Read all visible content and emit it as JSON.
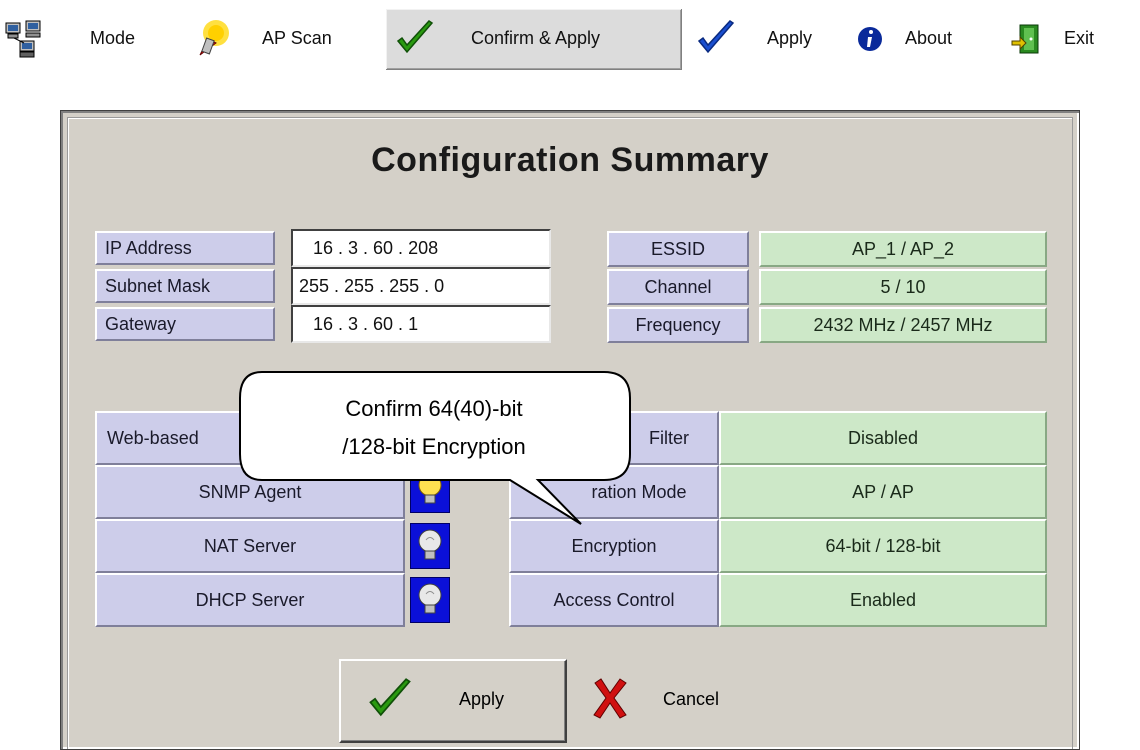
{
  "toolbar": {
    "mode": "Mode",
    "ap_scan": "AP Scan",
    "confirm_apply": "Confirm & Apply",
    "apply": "Apply",
    "about": "About",
    "exit": "Exit"
  },
  "dialog": {
    "title": "Configuration Summary",
    "network": {
      "ip_label": "IP Address",
      "ip_value": "16  .  3  .  60  . 208",
      "subnet_label": "Subnet Mask",
      "subnet_value": "255 . 255 . 255 .   0",
      "gateway_label": "Gateway",
      "gateway_value": "16  .  3  .  60  .   1"
    },
    "wireless": {
      "essid_label": "ESSID",
      "essid_value": "AP_1 / AP_2",
      "channel_label": "Channel",
      "channel_value": "5 / 10",
      "frequency_label": "Frequency",
      "frequency_value": "2432 MHz / 2457 MHz"
    },
    "services": {
      "web_label": "Web-based",
      "snmp_label": "SNMP Agent",
      "nat_label": "NAT Server",
      "dhcp_label": "DHCP Server"
    },
    "security": {
      "filter_label": "Filter",
      "filter_value": "Disabled",
      "operation_label": "ration Mode",
      "operation_value": "AP / AP",
      "encryption_label": "Encryption",
      "encryption_value": "64-bit / 128-bit",
      "access_label": "Access Control",
      "access_value": "Enabled"
    },
    "callout": {
      "line1": "Confirm 64(40)-bit",
      "line2": "/128-bit Encryption"
    },
    "buttons": {
      "apply": "Apply",
      "cancel": "Cancel"
    }
  },
  "colors": {
    "lavender": "#cdcdea",
    "green": "#cde8c8",
    "bulb_bg": "#0b10d8",
    "dialog_bg": "#d4d0c8"
  }
}
